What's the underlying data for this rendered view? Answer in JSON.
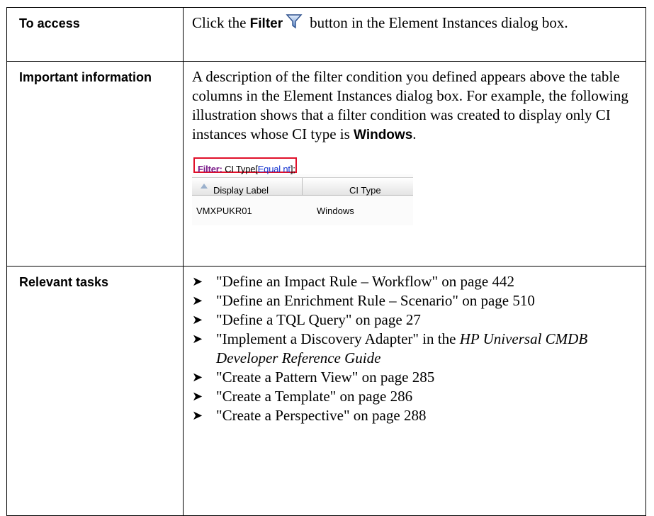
{
  "rows": {
    "access": {
      "header": "To access",
      "text_before": "Click the",
      "bold": "Filter",
      "text_after": "button in the Element Instances dialog box.",
      "icon": "filter-funnel-icon"
    },
    "important": {
      "header": "Important information",
      "text": "A description of the filter condition you defined appears above the table columns in the Element Instances dialog box. For example, the following illustration shows that a filter condition was created to display only CI instances whose CI type is ",
      "bold": "Windows",
      "end": ".",
      "illustration": {
        "filter_label": "Filter:",
        "filter_field": " CI Type[",
        "filter_value": "Equal nt",
        "filter_end": "];",
        "col1": "Display Label",
        "col2": "CI Type",
        "cell1": "VMXPUKR01",
        "cell2": "Windows",
        "highlight_color": "#e0102a"
      }
    },
    "tasks": {
      "header": "Relevant tasks",
      "items": [
        "\"Define an Impact Rule – Workflow\" on page 442",
        "\"Define an Enrichment Rule – Scenario\" on page 510",
        "\"Define a TQL Query\" on page 27",
        "\"Implement a Discovery Adapter\" in the ",
        "\"Create a Pattern View\" on page 285",
        "\"Create a Template\" on page 286",
        "\"Create a Perspective\" on page 288"
      ],
      "item4_italic": "HP Universal CMDB Developer Reference Guide",
      "bullet": "➤"
    }
  }
}
